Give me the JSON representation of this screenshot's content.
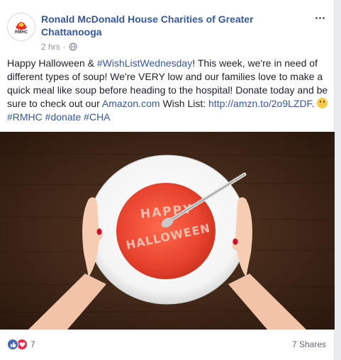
{
  "post": {
    "page_name": "Ronald McDonald House Charities of Greater Chattanooga",
    "avatar_text": "RMHC",
    "time": "2 hrs",
    "separator": "·",
    "text": {
      "part1": "Happy Halloween & ",
      "hashtag_wish": "#WishListWednesday",
      "part2": "! This week, we're in need of different types of soup! We're VERY low and our families love to make a quick meal like soup before heading to the hospital! Donate today and be sure to check out our ",
      "amazon_link": "Amazon.com",
      "part3": " Wish List: ",
      "url": "http://amzn.to/2o9LZDF",
      "part4": ". ",
      "hashtag_rmhc": "#RMHC",
      "hashtag_donate": "#donate",
      "hashtag_cha": "#CHA"
    },
    "image": {
      "soup_text_line1": "HAPPY",
      "soup_text_line2": "HALLOWEEN"
    },
    "footer": {
      "reaction_count": "7",
      "shares": "7 Shares"
    }
  },
  "colors": {
    "link": "#365899",
    "like": "#4267b2",
    "love": "#f0284a",
    "soup": "#e8432e",
    "table": "#3a2418"
  },
  "icons": [
    "more-options-icon",
    "globe-icon",
    "like-icon",
    "love-icon",
    "smile-emoji-icon"
  ]
}
